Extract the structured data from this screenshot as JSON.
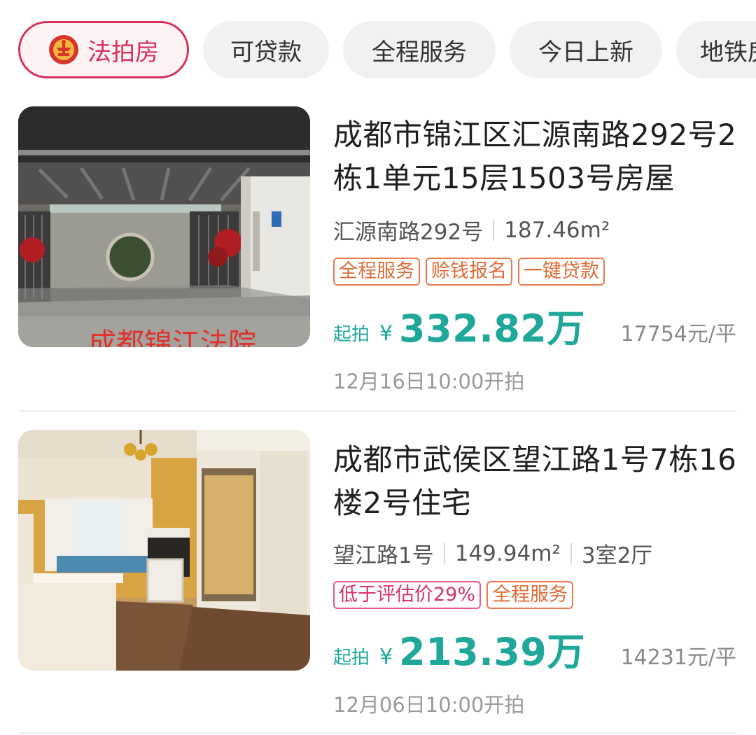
{
  "filters": [
    {
      "label": "法拍房",
      "active": true,
      "icon": "court-emblem-icon"
    },
    {
      "label": "可贷款",
      "active": false
    },
    {
      "label": "全程服务",
      "active": false
    },
    {
      "label": "今日上新",
      "active": false
    },
    {
      "label": "地铁房",
      "active": false
    }
  ],
  "listings": [
    {
      "title": "成都市锦江区汇源南路292号2栋1单元15层1503号房屋",
      "street": "汇源南路292号",
      "area": "187.46m²",
      "tags": [
        "全程服务",
        "赊钱报名",
        "一键贷款"
      ],
      "price_label": "起拍",
      "currency": "¥",
      "price": "332.82万",
      "unit_price": "17754元/平",
      "auction_time": "12月16日10:00开拍",
      "image_overlay_text": "成都锦江法院"
    },
    {
      "title": "成都市武侯区望江路1号7栋16楼2号住宅",
      "street": "望江路1号",
      "area": "149.94m²",
      "layout": "3室2厅",
      "tags": [
        "低于评估价29%",
        "全程服务"
      ],
      "price_label": "起拍",
      "currency": "¥",
      "price": "213.39万",
      "unit_price": "14231元/平",
      "auction_time": "12月06日10:00开拍"
    }
  ],
  "colors": {
    "accent": "#1fa79a",
    "brand_red": "#d8315a",
    "tag_orange": "#e06a35",
    "tag_pink": "#d8316a"
  }
}
